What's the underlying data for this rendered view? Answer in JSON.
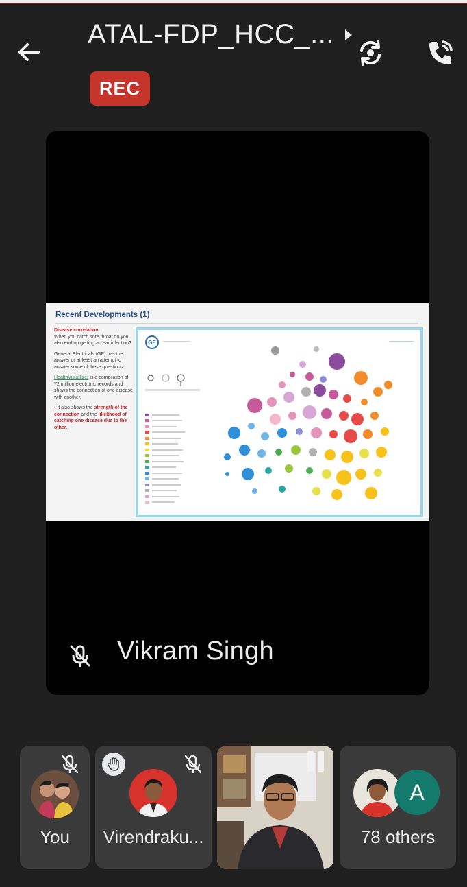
{
  "header": {
    "title": "ATAL-FDP_HCC_...",
    "rec_label": "REC",
    "back_icon": "arrow-back-icon",
    "switch_camera_icon": "switch-camera-icon",
    "call_icon": "phone-call-icon"
  },
  "main": {
    "speaker_name": "Vikram Singh",
    "speaker_mic_icon": "mic-off-icon",
    "slide": {
      "title": "Recent Developments (1)",
      "left_heading": "Disease correlation",
      "left_q": "When you catch sore throat do you also end up getting an ear infection?",
      "left_p2": "General Electricals (GE) has the answer or at least an attempt to answer some of these questions.",
      "left_link": "HealthVisualizer",
      "left_p3": "is a compilation of 72 million electronic records and shows the connection of one disease with another.",
      "left_p4_a": "• It also shows the",
      "left_p4_b": "strength of the connection",
      "left_p4_c": "and the",
      "left_p4_d": "likelihood of catching one disease due to the other."
    }
  },
  "participants": [
    {
      "label": "You",
      "mic": "mic-off-icon"
    },
    {
      "label": "Virendraku...",
      "mic": "mic-off-icon",
      "hand": "raised-hand-icon"
    },
    {
      "label": "",
      "status": "pause-icon"
    },
    {
      "label": "78 others",
      "initial": "A"
    }
  ],
  "colors": {
    "background": "#1f1f1f",
    "rec": "#c5352b",
    "tile": "#3a3a3a",
    "avatar_a": "#147a6c"
  }
}
